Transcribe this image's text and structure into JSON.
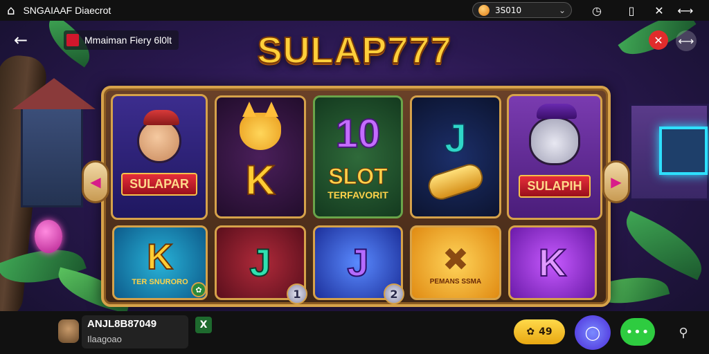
{
  "statusbar": {
    "title": "SNGAIAAF Diaecrot",
    "coins": "3S010"
  },
  "header": {
    "breadcrumb": "Mmaiman Fiery 6l0lt",
    "logo": "SULAP777"
  },
  "tiles": {
    "t1_banner": "SULAPAR",
    "t2_letter": "K",
    "t3_number": "10",
    "t3_word": "SLOT",
    "t3_sub": "TERFAVORIT",
    "t4_letter": "J",
    "t5_banner": "SULAPIH",
    "t6_letter": "K",
    "t6_caption": "TER SNURORO",
    "t7_letter": "J",
    "t8_letter": "J",
    "t9_caption": "PEMANS SSMA",
    "t10_letter": "K"
  },
  "badges": {
    "one": "1",
    "two": "2"
  },
  "bottombar": {
    "account_id": "ANJL8B87049",
    "account_sub": "Ilaagoao",
    "bonus_count": "49"
  },
  "colors": {
    "logo_gold": "#ffcf3a",
    "frame_gold": "#d6a24a",
    "close_red": "#e12c2c",
    "more_green": "#2ecc40"
  },
  "icons": [
    "home-icon",
    "clock-icon",
    "menu-icon",
    "close-icon",
    "shuffle-icon",
    "back-arrow-icon",
    "chat-icon",
    "more-icon",
    "pin-icon"
  ]
}
